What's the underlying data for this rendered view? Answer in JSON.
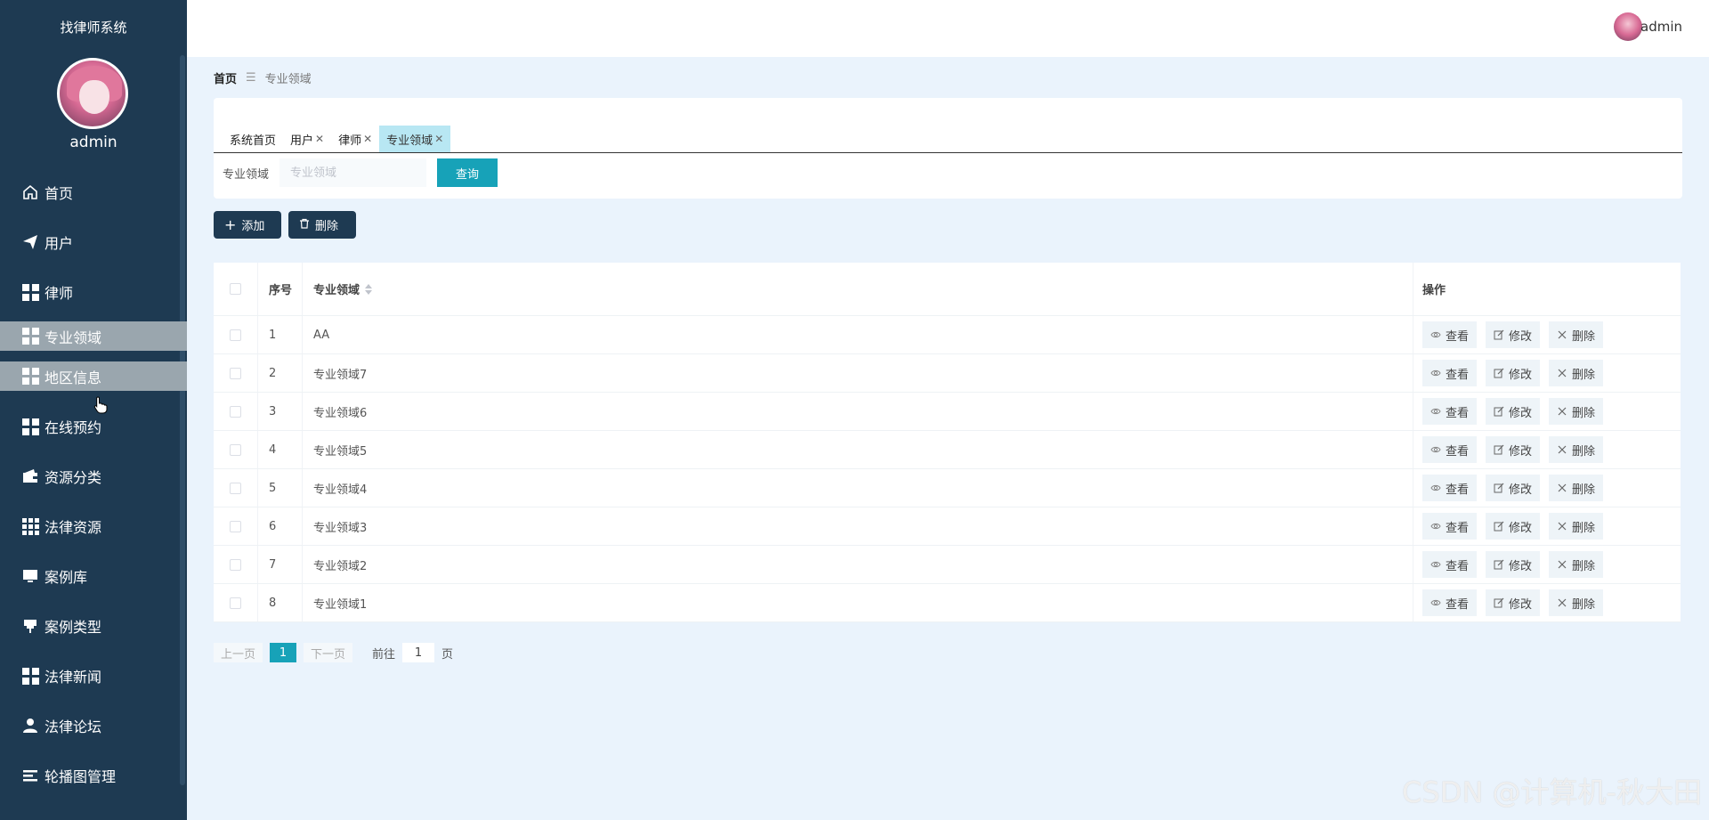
{
  "app": {
    "title": "找律师系统",
    "user": "admin"
  },
  "sidebar": {
    "items": [
      {
        "label": "首页",
        "icon": "home-icon"
      },
      {
        "label": "用户",
        "icon": "paper-plane-icon"
      },
      {
        "label": "律师",
        "icon": "grid-icon"
      },
      {
        "label": "专业领域",
        "icon": "grid-icon",
        "state": "active"
      },
      {
        "label": "地区信息",
        "icon": "grid-icon",
        "state": "hover"
      },
      {
        "label": "在线预约",
        "icon": "grid-icon"
      },
      {
        "label": "资源分类",
        "icon": "wallet-icon"
      },
      {
        "label": "法律资源",
        "icon": "grid9-icon"
      },
      {
        "label": "案例库",
        "icon": "monitor-icon"
      },
      {
        "label": "案例类型",
        "icon": "pushpin-icon"
      },
      {
        "label": "法律新闻",
        "icon": "grid-icon"
      },
      {
        "label": "法律论坛",
        "icon": "user-icon"
      },
      {
        "label": "轮播图管理",
        "icon": "list-icon"
      }
    ]
  },
  "header": {
    "user": "admin"
  },
  "breadcrumb": {
    "home": "首页",
    "current": "专业领域"
  },
  "tabs": [
    {
      "label": "系统首页",
      "closable": false
    },
    {
      "label": "用户",
      "closable": true
    },
    {
      "label": "律师",
      "closable": true
    },
    {
      "label": "专业领域",
      "closable": true,
      "active": true
    }
  ],
  "search": {
    "label": "专业领域",
    "placeholder": "专业领域",
    "button": "查询"
  },
  "actions": {
    "add": "添加",
    "delete": "删除"
  },
  "table": {
    "columns": {
      "index": "序号",
      "name": "专业领域",
      "ops": "操作"
    },
    "op_labels": {
      "view": "查看",
      "edit": "修改",
      "delete": "删除"
    },
    "rows": [
      {
        "index": "1",
        "name": "AA"
      },
      {
        "index": "2",
        "name": "专业领域7"
      },
      {
        "index": "3",
        "name": "专业领域6"
      },
      {
        "index": "4",
        "name": "专业领域5"
      },
      {
        "index": "5",
        "name": "专业领域4"
      },
      {
        "index": "6",
        "name": "专业领域3"
      },
      {
        "index": "7",
        "name": "专业领域2"
      },
      {
        "index": "8",
        "name": "专业领域1"
      }
    ]
  },
  "pagination": {
    "prev": "上一页",
    "current": "1",
    "next": "下一页",
    "goto": "前往",
    "goto_value": "1",
    "unit": "页"
  },
  "watermark": "CSDN @计算机-秋大田",
  "colors": {
    "sidebar": "#1e3a52",
    "accent": "#17a2b8",
    "active_menu": "#9aa6ae",
    "background": "#eaf3fc"
  }
}
